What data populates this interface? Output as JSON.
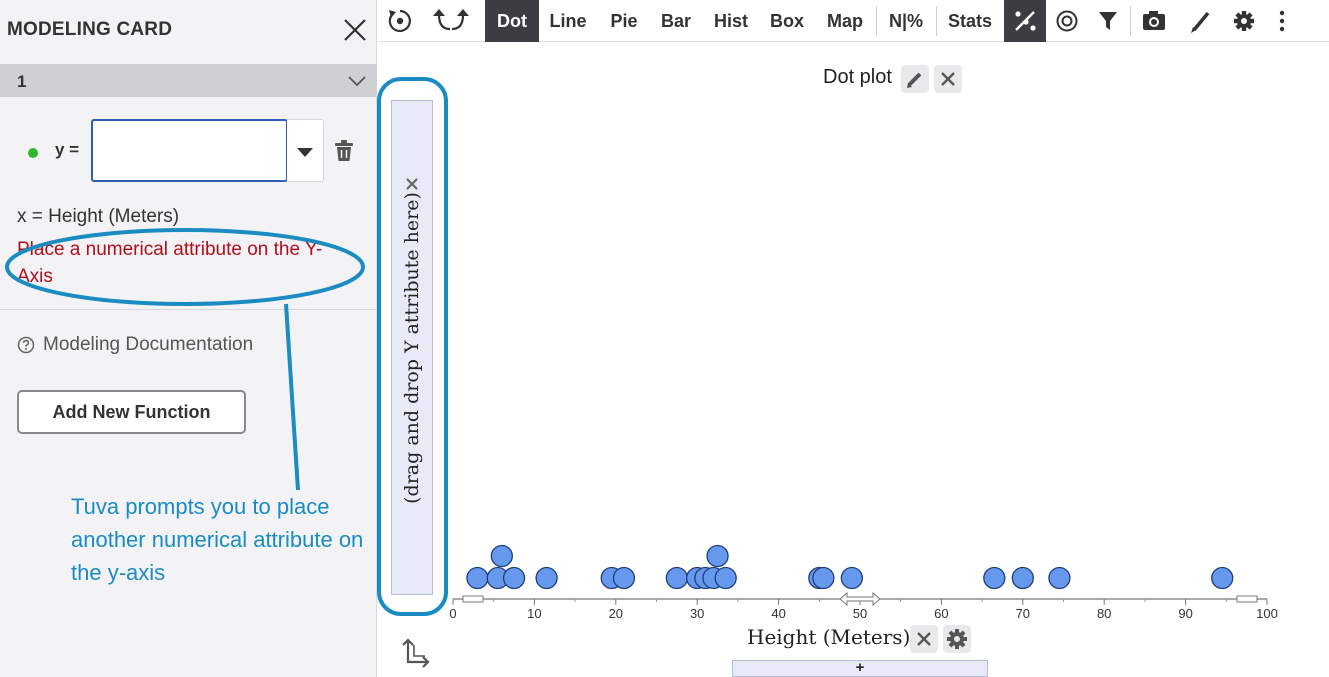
{
  "card": {
    "title": "MODELING CARD",
    "section_number": "1",
    "y_label": "y =",
    "y_input_value": "",
    "y_input_placeholder": "",
    "x_text": "x = Height (Meters)",
    "error_text": "Place a numerical attribute on the Y-Axis",
    "doc_link": "Modeling Documentation",
    "add_button": "Add New Function",
    "status_color": "#2fb52f"
  },
  "annotation": {
    "text": "Tuva prompts you to place another numerical attribute on the y-axis",
    "color": "#1a8cc2"
  },
  "toolbar": {
    "items": [
      {
        "label": "Dot",
        "active": true
      },
      {
        "label": "Line",
        "active": false
      },
      {
        "label": "Pie",
        "active": false
      },
      {
        "label": "Bar",
        "active": false
      },
      {
        "label": "Hist",
        "active": false
      },
      {
        "label": "Box",
        "active": false
      },
      {
        "label": "Map",
        "active": false
      },
      {
        "label": "N|%",
        "active": false
      },
      {
        "label": "Stats",
        "active": false
      }
    ],
    "icons": [
      "reset-icon",
      "undo-redo-icon",
      "modeling-icon",
      "target-icon",
      "filter-icon",
      "camera-icon",
      "pen-icon",
      "gear-icon",
      "more-icon"
    ],
    "active_color": "#3b3d42"
  },
  "graph": {
    "title": "Dot plot",
    "y_drop_text": "(drag and drop Y attribute here)",
    "x_axis_label": "Height (Meters)",
    "add_attribute": "+"
  },
  "chart_data": {
    "type": "scatter",
    "title": "Dot plot",
    "xlabel": "Height (Meters)",
    "ylabel": "",
    "xlim": [
      0,
      100
    ],
    "x_ticks": [
      0,
      10,
      20,
      30,
      40,
      50,
      60,
      70,
      80,
      90,
      100
    ],
    "x": [
      3,
      5.5,
      6,
      7.5,
      11.5,
      19.5,
      21,
      27.5,
      30,
      31,
      32,
      32.5,
      33.5,
      45,
      45.5,
      49,
      66.5,
      70,
      74.5,
      94.5
    ],
    "stack": [
      0,
      0,
      1,
      0,
      0,
      0,
      0,
      0,
      0,
      0,
      0,
      1,
      0,
      0,
      0,
      0,
      0,
      0,
      0,
      0
    ],
    "point_color": "#6699ee",
    "grid": false
  }
}
